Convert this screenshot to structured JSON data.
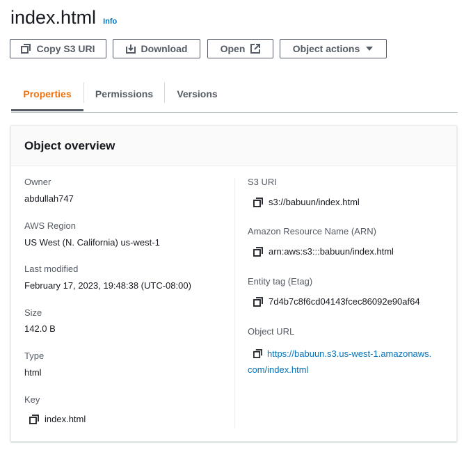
{
  "header": {
    "title": "index.html",
    "info_label": "Info"
  },
  "actions": {
    "copy_s3_uri": "Copy S3 URI",
    "download": "Download",
    "open": "Open",
    "object_actions": "Object actions"
  },
  "tabs": [
    {
      "label": "Properties",
      "active": true
    },
    {
      "label": "Permissions",
      "active": false
    },
    {
      "label": "Versions",
      "active": false
    }
  ],
  "overview": {
    "title": "Object overview",
    "left": {
      "owner_label": "Owner",
      "owner": "abdullah747",
      "region_label": "AWS Region",
      "region": "US West (N. California) us-west-1",
      "modified_label": "Last modified",
      "modified": "February 17, 2023, 19:48:38 (UTC-08:00)",
      "size_label": "Size",
      "size": "142.0 B",
      "type_label": "Type",
      "type": "html",
      "key_label": "Key",
      "key": "index.html"
    },
    "right": {
      "s3uri_label": "S3 URI",
      "s3uri": "s3://babuun/index.html",
      "arn_label": "Amazon Resource Name (ARN)",
      "arn": "arn:aws:s3:::babuun/index.html",
      "etag_label": "Entity tag (Etag)",
      "etag": "7d4b7c8f6cd04143fcec86092e90af64",
      "url_label": "Object URL",
      "url_line1": "https://babuun.s3.us-west-1.amazonaws.",
      "url_line2": "com/index.html"
    }
  },
  "colors": {
    "accent": "#ec7211",
    "link": "#0073bb",
    "text": "#16191f",
    "muted": "#545b64"
  },
  "icons": [
    "copy-icon",
    "download-icon",
    "external-link-icon",
    "caret-down-icon"
  ]
}
